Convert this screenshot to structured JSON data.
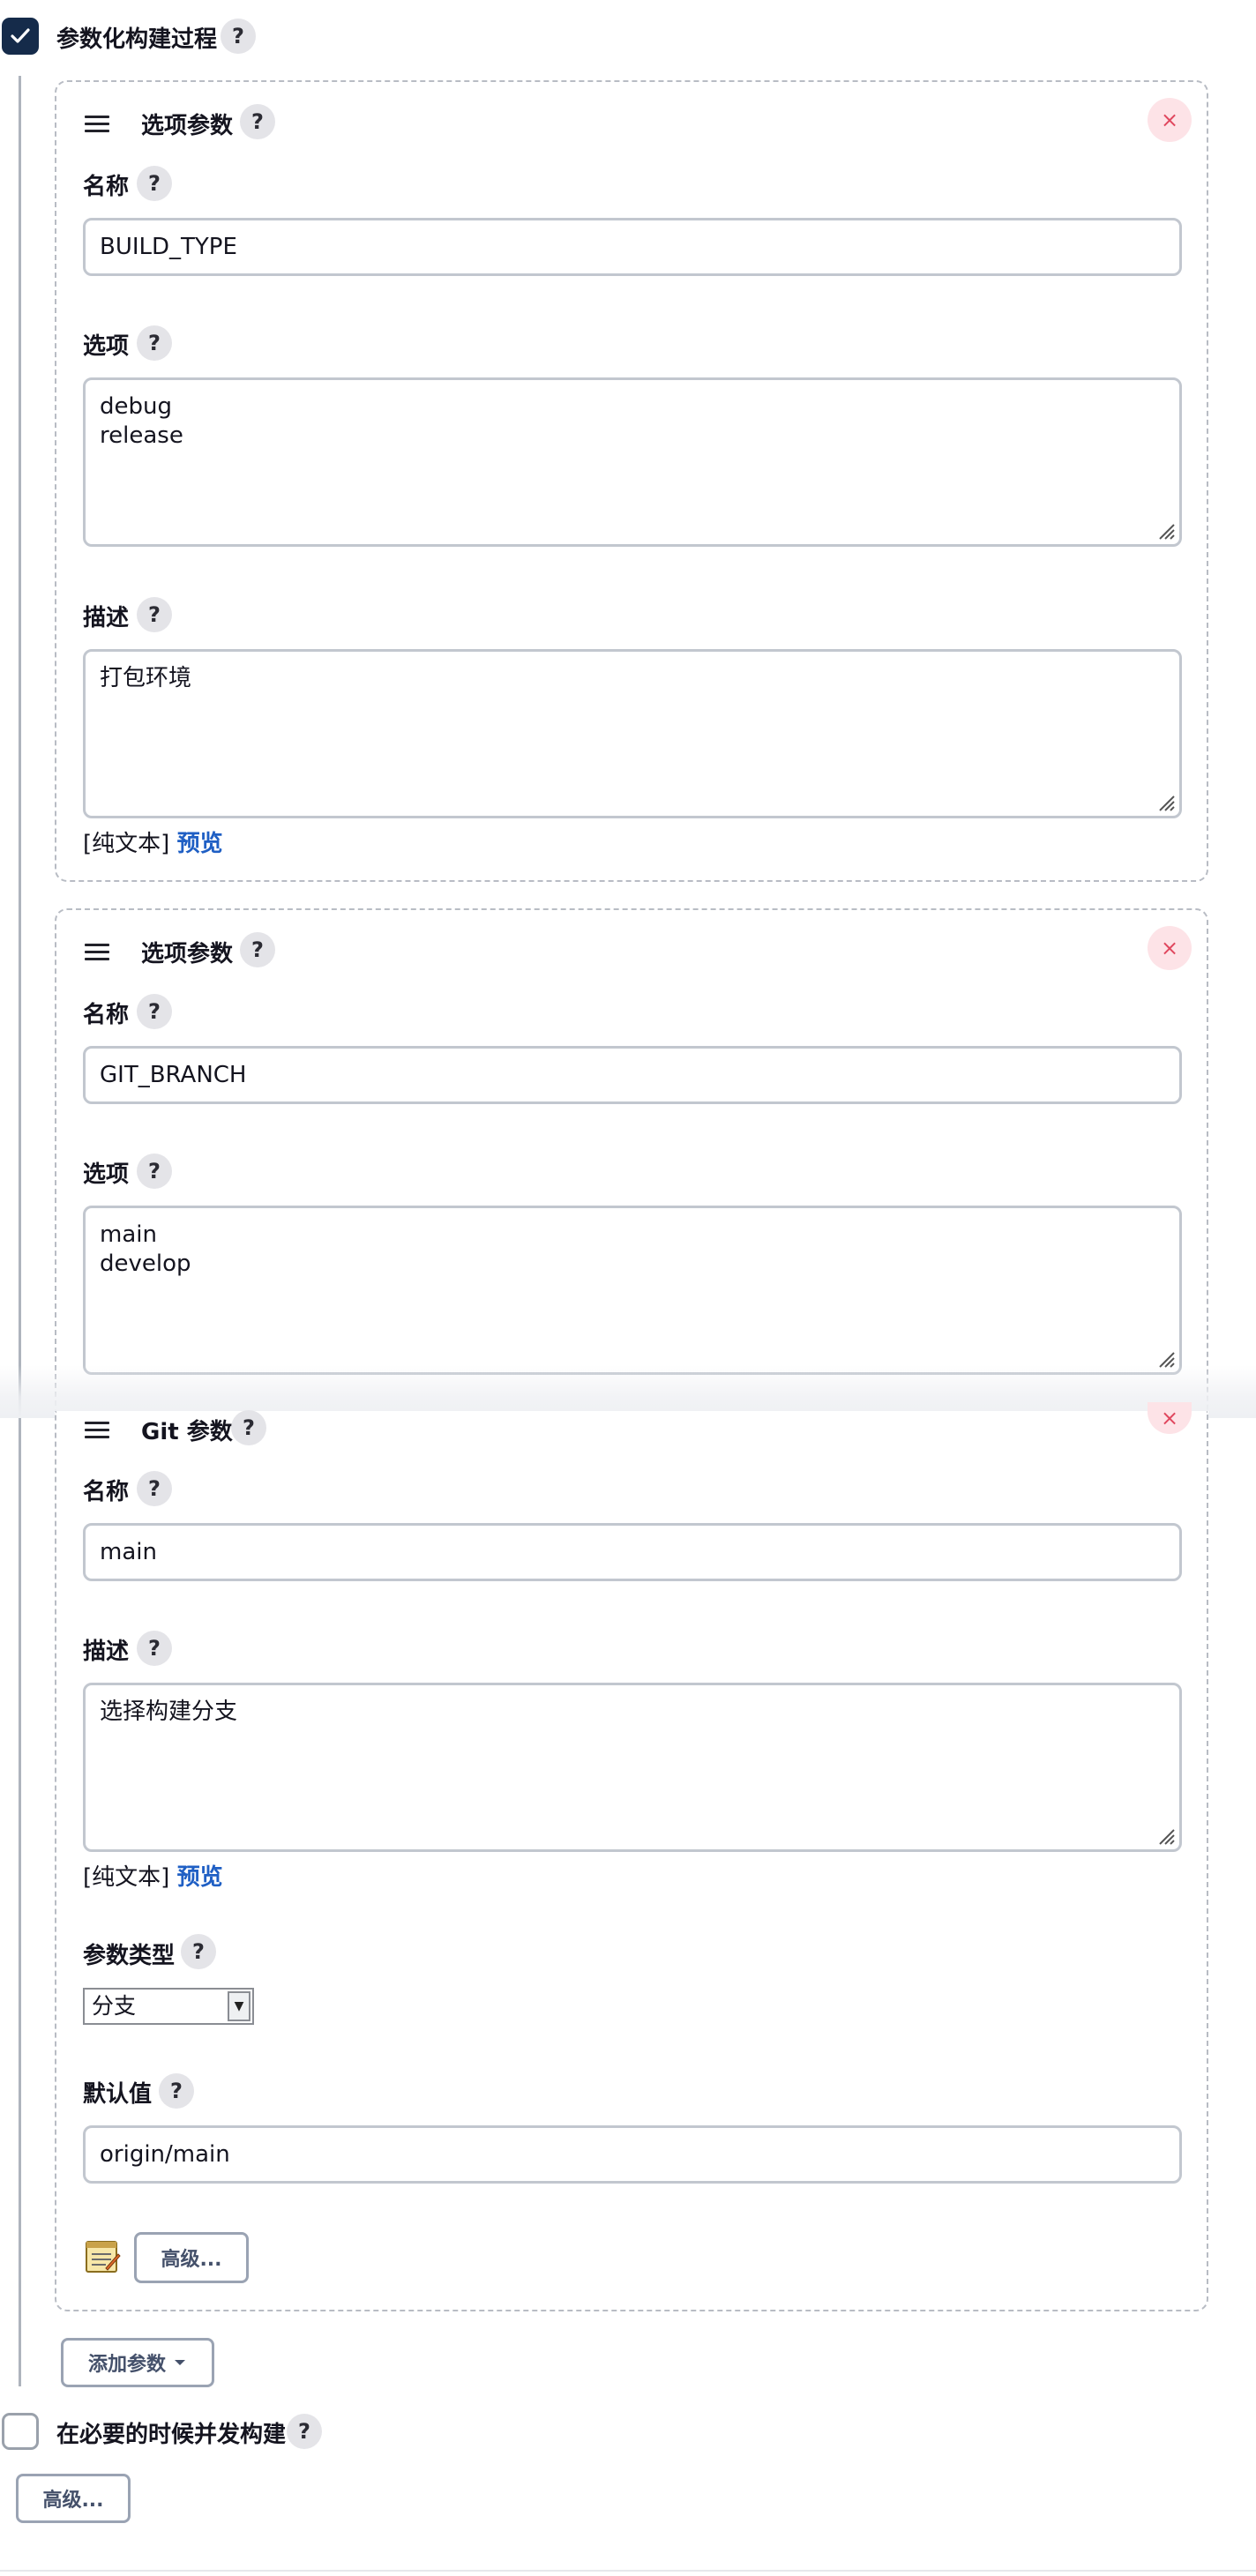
{
  "top": {
    "parameterized_label": "参数化构建过程",
    "help": "?"
  },
  "cards": [
    {
      "type_label": "选项参数",
      "name_label": "名称",
      "name_value": "BUILD_TYPE",
      "choices_label": "选项",
      "choices": [
        "debug",
        "release"
      ],
      "desc_label": "描述",
      "desc_value": "打包环境",
      "plain_text": "[纯文本]",
      "preview": "预览",
      "close": "×"
    },
    {
      "type_label": "选项参数",
      "name_label": "名称",
      "name_value": "GIT_BRANCH",
      "choices_label": "选项",
      "choices": [
        "main",
        "develop"
      ],
      "close": "×"
    },
    {
      "type_label": "Git 参数",
      "name_label": "名称",
      "name_value": "main",
      "desc_label": "描述",
      "desc_value": "选择构建分支",
      "plain_text": "[纯文本]",
      "preview": "预览",
      "param_type_label": "参数类型",
      "param_type_value": "分支",
      "default_label": "默认值",
      "default_value": "origin/main",
      "advanced": "高级...",
      "close": "×"
    }
  ],
  "add_param": "添加参数",
  "concurrent_label": "在必要的时候并发构建",
  "advanced_bottom": "高级...",
  "icons": {
    "checkbox_checked": "check-icon",
    "drag": "drag-handle-icon",
    "close": "close-icon",
    "notepad": "notepad-icon",
    "caret": "caret-down-icon"
  },
  "colors": {
    "checkbox": "#152b4a",
    "link": "#1f5fc4",
    "close_bg": "#fde3e7",
    "close_fg": "#e0475e"
  }
}
